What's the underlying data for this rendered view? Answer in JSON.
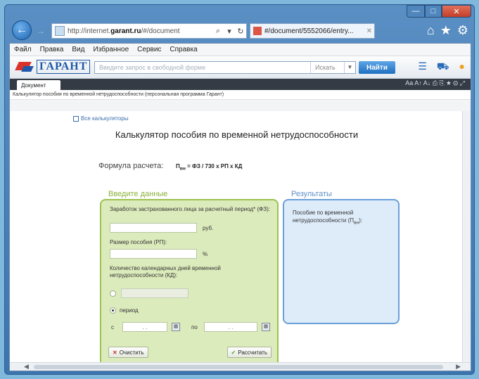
{
  "browser": {
    "address_url_grey": "http://internet.",
    "address_url_bold": "garant.ru",
    "address_url_tail": "/#/document",
    "tab_title": "#/document/5552066/entry...",
    "menu": [
      "Файл",
      "Правка",
      "Вид",
      "Избранное",
      "Сервис",
      "Справка"
    ],
    "window_controls": {
      "minimize": "—",
      "maximize": "□",
      "close": "✕"
    }
  },
  "app": {
    "logo_text": "ГАРАНТ",
    "search_placeholder": "Введите запрос в свободной форме",
    "search_option": "Искать",
    "search_button": "Найти",
    "doc_tab": "Документ",
    "doc_tab_icons": "Aa  A↑  A↓   ⎙  ⎘  ★  ⚙  ⤢",
    "breadcrumb": "Калькулятор пособия по временной нетрудоспособности (персональная программа Гарант)"
  },
  "calculator": {
    "all_calculators_link": "Все калькуляторы",
    "title": "Калькулятор пособия по временной нетрудоспособности",
    "formula_label": "Формула расчета:",
    "formula_value": "П",
    "formula_sub": "вн",
    "formula_rest": " = ФЗ / 730 х РП х КД",
    "input_section_title": "Введите данные",
    "result_section_title": "Результаты",
    "earnings_label": "Заработок застрахованного лица за расчетный период* (ФЗ):",
    "earnings_unit": "руб.",
    "benefit_size_label": "Размер пособия (РП):",
    "benefit_size_unit": "%",
    "days_label": "Количество календарных дней временной нетрудоспособности (КД):",
    "period_label": "период",
    "date_from_label": "с",
    "date_to_label": "по",
    "date_placeholder": ".   .",
    "clear_button": "Очистить",
    "calculate_button": "Рассчитать",
    "result_text": "Пособие по временной нетрудоспособности (П",
    "result_sub": "вн",
    "result_tail": "):"
  }
}
